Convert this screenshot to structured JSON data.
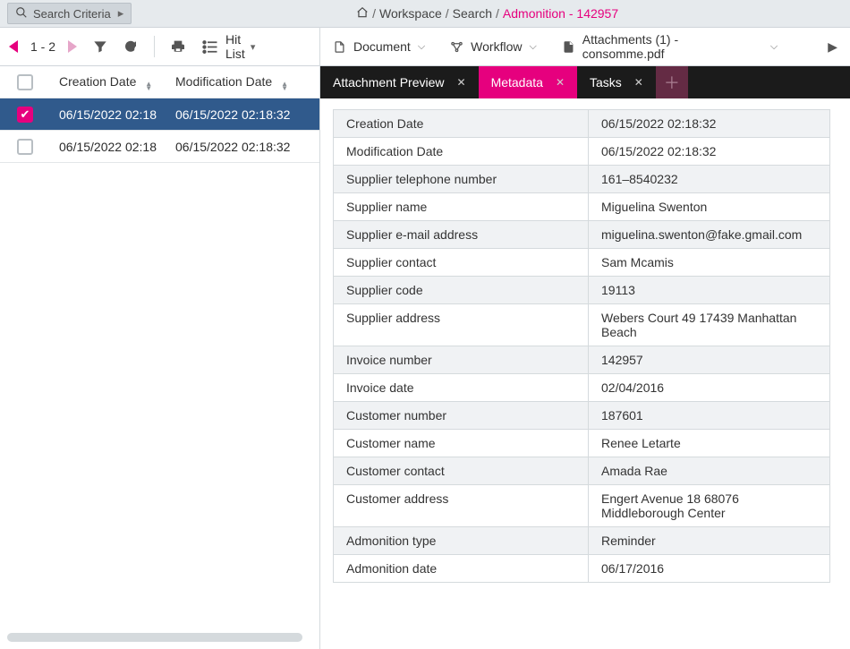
{
  "searchCriteria": {
    "label": "Search Criteria"
  },
  "breadcrumb": {
    "items": [
      "Workspace",
      "Search"
    ],
    "current": "Admonition - 142957"
  },
  "leftToolbar": {
    "pagerRange": "1 - 2",
    "hitListLabel": "Hit List"
  },
  "resultTable": {
    "headers": {
      "c1": "Creation Date",
      "c2": "Modification Date"
    },
    "rows": [
      {
        "selected": true,
        "c1": "06/15/2022 02:18",
        "c2": "06/15/2022 02:18:32"
      },
      {
        "selected": false,
        "c1": "06/15/2022 02:18",
        "c2": "06/15/2022 02:18:32"
      }
    ]
  },
  "rightToolbar": {
    "document": "Document",
    "workflow": "Workflow",
    "attachmentsLabel": "Attachments (1) - consomme.pdf"
  },
  "tabs": [
    {
      "label": "Attachment Preview",
      "active": false,
      "closable": true
    },
    {
      "label": "Metadata",
      "active": true,
      "closable": true
    },
    {
      "label": "Tasks",
      "active": false,
      "closable": true
    }
  ],
  "metadata": [
    {
      "key": "Creation Date",
      "value": "06/15/2022 02:18:32"
    },
    {
      "key": "Modification Date",
      "value": "06/15/2022 02:18:32"
    },
    {
      "key": "Supplier telephone number",
      "value": "161–8540232"
    },
    {
      "key": "Supplier name",
      "value": "Miguelina Swenton"
    },
    {
      "key": "Supplier e-mail address",
      "value": "miguelina.swenton@fake.gmail.com"
    },
    {
      "key": "Supplier contact",
      "value": "Sam Mcamis"
    },
    {
      "key": "Supplier code",
      "value": "19113"
    },
    {
      "key": "Supplier address",
      "value": "Webers Court 49 17439 Manhattan Beach"
    },
    {
      "key": "Invoice number",
      "value": "142957"
    },
    {
      "key": "Invoice date",
      "value": "02/04/2016"
    },
    {
      "key": "Customer number",
      "value": "187601"
    },
    {
      "key": "Customer name",
      "value": "Renee Letarte"
    },
    {
      "key": "Customer contact",
      "value": "Amada Rae"
    },
    {
      "key": "Customer address",
      "value": "Engert Avenue 18 68076 Middleborough Center"
    },
    {
      "key": "Admonition type",
      "value": "Reminder"
    },
    {
      "key": "Admonition date",
      "value": "06/17/2016"
    }
  ]
}
